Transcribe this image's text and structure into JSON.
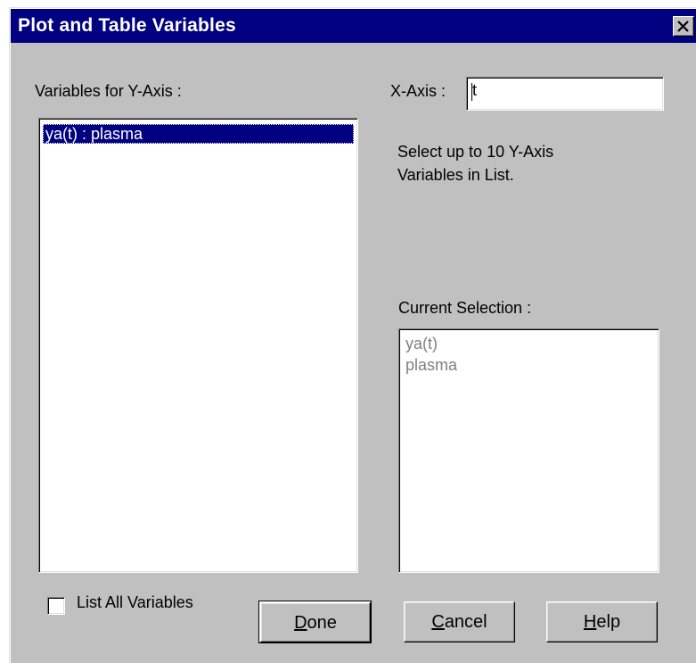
{
  "window": {
    "title": "Plot and Table Variables",
    "close_icon": "close-icon"
  },
  "yaxis": {
    "label": "Variables for Y-Axis :",
    "items": [
      {
        "text": "ya(t) : plasma",
        "selected": true
      }
    ]
  },
  "xaxis": {
    "label": "X-Axis :",
    "value": "t"
  },
  "instructions": {
    "line1": "Select up to 10 Y-Axis",
    "line2": "Variables in List."
  },
  "current_selection": {
    "label": "Current Selection :",
    "lines": [
      "ya(t)",
      "plasma"
    ]
  },
  "list_all": {
    "label": "List All Variables",
    "checked": false
  },
  "buttons": {
    "done": {
      "mnemonic": "D",
      "rest": "one"
    },
    "cancel": {
      "mnemonic": "C",
      "rest": "ancel"
    },
    "help": {
      "mnemonic": "H",
      "rest": "elp"
    }
  },
  "colors": {
    "titlebar": "#000080",
    "face": "#c0c0c0",
    "selection": "#000080",
    "disabled_text": "#808080"
  }
}
